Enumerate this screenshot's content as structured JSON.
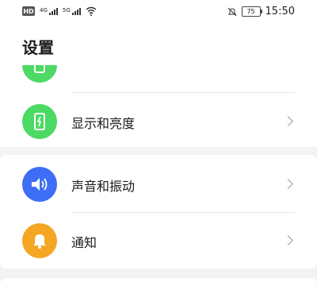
{
  "status_bar": {
    "left_badge": "HD",
    "sim1_network": "4G",
    "sim2_network": "5G",
    "battery_level": "75",
    "time": "15:50",
    "icons": [
      "hd-icon",
      "signal-icon",
      "signal-icon",
      "wifi-icon",
      "mute-icon",
      "battery-icon"
    ]
  },
  "header": {
    "title": "设置"
  },
  "settings": {
    "items": [
      {
        "label": "",
        "icon": "display-icon",
        "color": "#4cd964"
      },
      {
        "label": "显示和亮度",
        "icon": "display-brightness-icon",
        "color": "#4cd964"
      },
      {
        "label": "声音和振动",
        "icon": "sound-icon",
        "color": "#3d6ef5"
      },
      {
        "label": "通知",
        "icon": "bell-icon",
        "color": "#f5a623"
      }
    ]
  }
}
